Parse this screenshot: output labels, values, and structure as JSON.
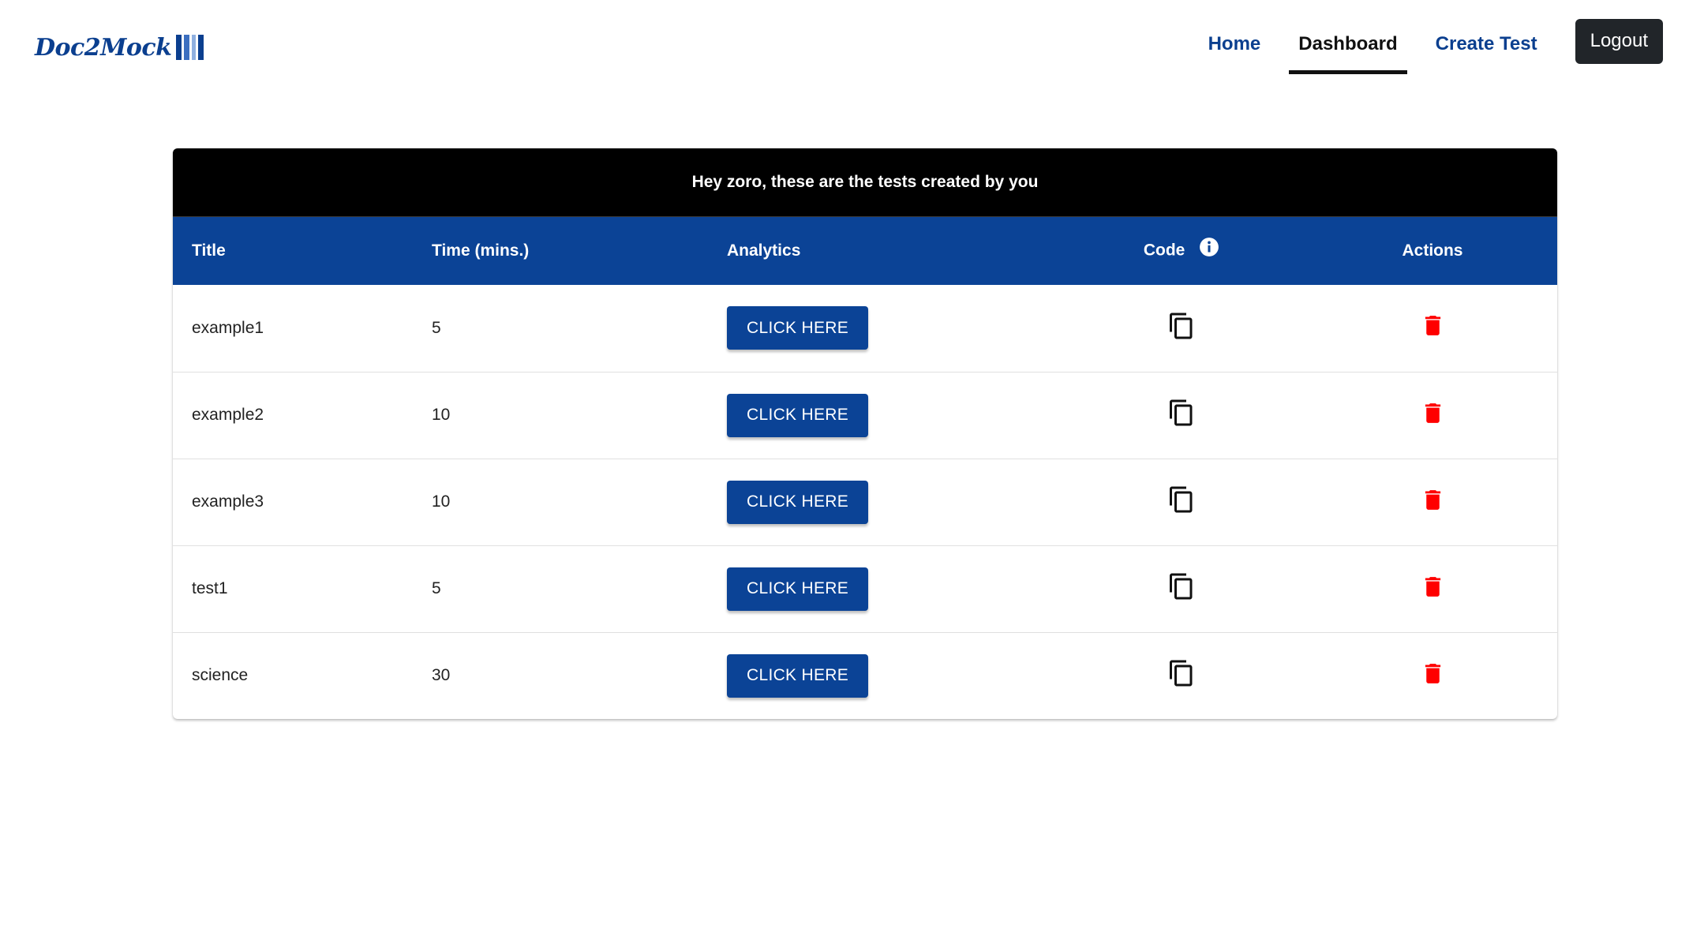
{
  "brand": {
    "name": "Doc2Mock",
    "colors": {
      "primary": "#0b4396",
      "dark": "#212529",
      "delete": "#ff0000"
    }
  },
  "nav": {
    "items": [
      {
        "label": "Home",
        "active": false
      },
      {
        "label": "Dashboard",
        "active": true
      },
      {
        "label": "Create Test",
        "active": false
      }
    ],
    "logout_label": "Logout"
  },
  "table": {
    "caption": "Hey zoro, these are the tests created by you",
    "columns": {
      "title": "Title",
      "time": "Time (mins.)",
      "analytics": "Analytics",
      "code": "Code",
      "actions": "Actions"
    },
    "code_info_icon": "info-icon",
    "rows": [
      {
        "title": "example1",
        "time": "5",
        "analytics_label": "CLICK HERE",
        "code_icon": "copy-icon",
        "action_icon": "delete-icon"
      },
      {
        "title": "example2",
        "time": "10",
        "analytics_label": "CLICK HERE",
        "code_icon": "copy-icon",
        "action_icon": "delete-icon"
      },
      {
        "title": "example3",
        "time": "10",
        "analytics_label": "CLICK HERE",
        "code_icon": "copy-icon",
        "action_icon": "delete-icon"
      },
      {
        "title": "test1",
        "time": "5",
        "analytics_label": "CLICK HERE",
        "code_icon": "copy-icon",
        "action_icon": "delete-icon"
      },
      {
        "title": "science",
        "time": "30",
        "analytics_label": "CLICK HERE",
        "code_icon": "copy-icon",
        "action_icon": "delete-icon"
      }
    ]
  }
}
